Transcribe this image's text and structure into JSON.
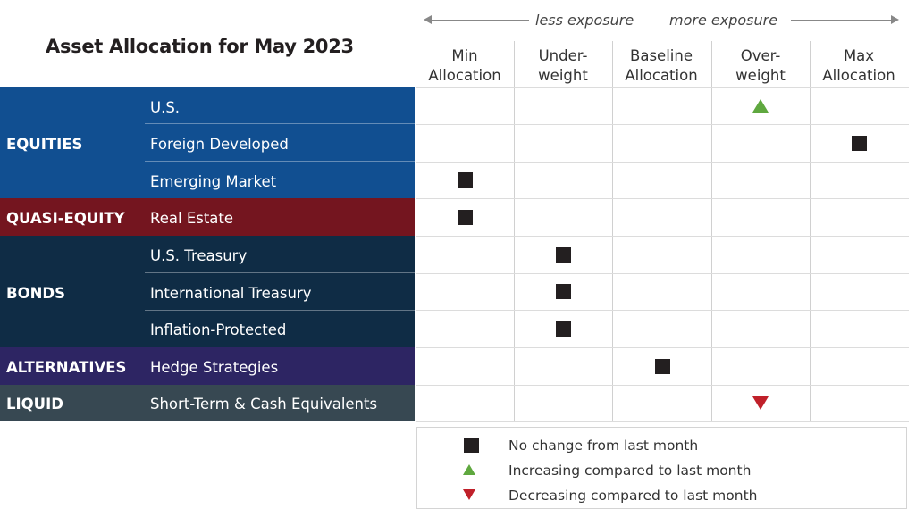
{
  "title": "Asset Allocation for May 2023",
  "exposure": {
    "less": "less exposure",
    "more": "more exposure"
  },
  "colors": {
    "equities": "#114f91",
    "quasi_equity": "#74151f",
    "bonds": "#0f2c45",
    "alternatives": "#2d2563",
    "liquid": "#374852",
    "increase": "#5fa83f",
    "decrease": "#c0202a",
    "no_change": "#231f20"
  },
  "columns": [
    {
      "line1": "Min",
      "line2": "Allocation"
    },
    {
      "line1": "Under-",
      "line2": "weight"
    },
    {
      "line1": "Baseline",
      "line2": "Allocation"
    },
    {
      "line1": "Over-",
      "line2": "weight"
    },
    {
      "line1": "Max",
      "line2": "Allocation"
    }
  ],
  "groups": [
    {
      "label": "EQUITIES",
      "items": [
        "U.S.",
        "Foreign Developed",
        "Emerging Market"
      ]
    },
    {
      "label": "QUASI-EQUITY",
      "items": [
        "Real Estate"
      ]
    },
    {
      "label": "BONDS",
      "items": [
        "U.S. Treasury",
        "International Treasury",
        "Inflation-Protected"
      ]
    },
    {
      "label": "ALTERNATIVES",
      "items": [
        "Hedge Strategies"
      ]
    },
    {
      "label": "LIQUID",
      "items": [
        "Short-Term & Cash Equivalents"
      ]
    }
  ],
  "legend": [
    {
      "symbol": "square",
      "text": "No change from last month"
    },
    {
      "symbol": "triangle-up",
      "text": "Increasing compared to last month"
    },
    {
      "symbol": "triangle-down",
      "text": "Decreasing compared to last month"
    }
  ],
  "chart_data": {
    "type": "table",
    "title": "Asset Allocation for May 2023",
    "columns": [
      "Min Allocation",
      "Underweight",
      "Baseline Allocation",
      "Overweight",
      "Max Allocation"
    ],
    "rows": [
      {
        "group": "EQUITIES",
        "asset": "U.S.",
        "allocation": "Overweight",
        "change": "increasing"
      },
      {
        "group": "EQUITIES",
        "asset": "Foreign Developed",
        "allocation": "Max Allocation",
        "change": "no change"
      },
      {
        "group": "EQUITIES",
        "asset": "Emerging Market",
        "allocation": "Min Allocation",
        "change": "no change"
      },
      {
        "group": "QUASI-EQUITY",
        "asset": "Real Estate",
        "allocation": "Min Allocation",
        "change": "no change"
      },
      {
        "group": "BONDS",
        "asset": "U.S. Treasury",
        "allocation": "Underweight",
        "change": "no change"
      },
      {
        "group": "BONDS",
        "asset": "International Treasury",
        "allocation": "Underweight",
        "change": "no change"
      },
      {
        "group": "BONDS",
        "asset": "Inflation-Protected",
        "allocation": "Underweight",
        "change": "no change"
      },
      {
        "group": "ALTERNATIVES",
        "asset": "Hedge Strategies",
        "allocation": "Baseline Allocation",
        "change": "no change"
      },
      {
        "group": "LIQUID",
        "asset": "Short-Term & Cash Equivalents",
        "allocation": "Overweight",
        "change": "decreasing"
      }
    ],
    "axis_note": "left = less exposure, right = more exposure"
  }
}
